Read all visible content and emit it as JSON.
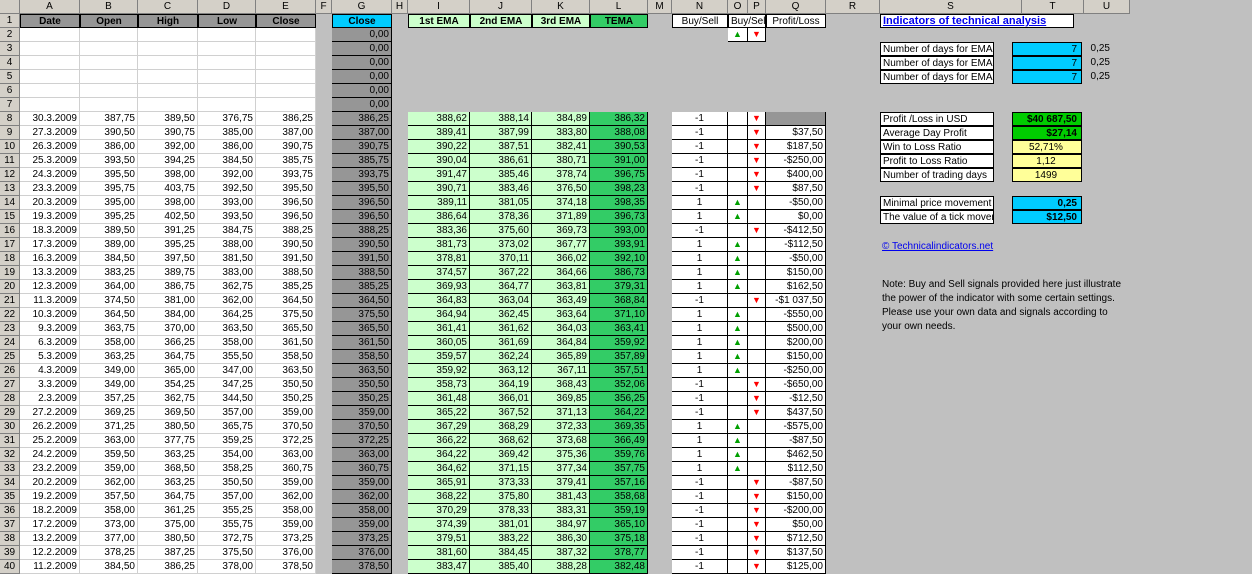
{
  "columns": [
    "A",
    "B",
    "C",
    "D",
    "E",
    "F",
    "G",
    "H",
    "I",
    "J",
    "K",
    "L",
    "M",
    "N",
    "O",
    "P",
    "Q",
    "R",
    "S",
    "T",
    "U"
  ],
  "header_labels": {
    "date": "Date",
    "open": "Open",
    "high": "High",
    "low": "Low",
    "close": "Close",
    "close2": "Close",
    "ema1": "1st EMA",
    "ema2": "2nd EMA",
    "ema3": "3rd EMA",
    "tema": "TEMA",
    "buysell": "Buy/Sell",
    "buysell2": "Buy/Sell",
    "profitloss": "Profit/Loss"
  },
  "signal_arrows": {
    "up": "▲",
    "down": "▼"
  },
  "empty_close": [
    "0,00",
    "0,00",
    "0,00",
    "0,00",
    "0,00",
    "0,00"
  ],
  "rows": [
    {
      "date": "30.3.2009",
      "open": "387,75",
      "high": "389,50",
      "low": "376,75",
      "close": "386,25",
      "g": "386,25",
      "i": "388,62",
      "j": "388,14",
      "k": "384,89",
      "l": "386,32",
      "n": "-1",
      "sig": "down",
      "q": ""
    },
    {
      "date": "27.3.2009",
      "open": "390,50",
      "high": "390,75",
      "low": "385,00",
      "close": "387,00",
      "g": "387,00",
      "i": "389,41",
      "j": "387,99",
      "k": "383,80",
      "l": "388,08",
      "n": "-1",
      "sig": "down",
      "q": "$37,50"
    },
    {
      "date": "26.3.2009",
      "open": "386,00",
      "high": "392,00",
      "low": "386,00",
      "close": "390,75",
      "g": "390,75",
      "i": "390,22",
      "j": "387,51",
      "k": "382,41",
      "l": "390,53",
      "n": "-1",
      "sig": "down",
      "q": "$187,50"
    },
    {
      "date": "25.3.2009",
      "open": "393,50",
      "high": "394,25",
      "low": "384,50",
      "close": "385,75",
      "g": "385,75",
      "i": "390,04",
      "j": "386,61",
      "k": "380,71",
      "l": "391,00",
      "n": "-1",
      "sig": "down",
      "q": "-$250,00"
    },
    {
      "date": "24.3.2009",
      "open": "395,50",
      "high": "398,00",
      "low": "392,00",
      "close": "393,75",
      "g": "393,75",
      "i": "391,47",
      "j": "385,46",
      "k": "378,74",
      "l": "396,75",
      "n": "-1",
      "sig": "down",
      "q": "$400,00"
    },
    {
      "date": "23.3.2009",
      "open": "395,75",
      "high": "403,75",
      "low": "392,50",
      "close": "395,50",
      "g": "395,50",
      "i": "390,71",
      "j": "383,46",
      "k": "376,50",
      "l": "398,23",
      "n": "-1",
      "sig": "down",
      "q": "$87,50"
    },
    {
      "date": "20.3.2009",
      "open": "395,00",
      "high": "398,00",
      "low": "393,00",
      "close": "396,50",
      "g": "396,50",
      "i": "389,11",
      "j": "381,05",
      "k": "374,18",
      "l": "398,35",
      "n": "1",
      "sig": "up",
      "q": "-$50,00"
    },
    {
      "date": "19.3.2009",
      "open": "395,25",
      "high": "402,50",
      "low": "393,50",
      "close": "396,50",
      "g": "396,50",
      "i": "386,64",
      "j": "378,36",
      "k": "371,89",
      "l": "396,73",
      "n": "1",
      "sig": "up",
      "q": "$0,00"
    },
    {
      "date": "18.3.2009",
      "open": "389,50",
      "high": "391,25",
      "low": "384,75",
      "close": "388,25",
      "g": "388,25",
      "i": "383,36",
      "j": "375,60",
      "k": "369,73",
      "l": "393,00",
      "n": "-1",
      "sig": "down",
      "q": "-$412,50"
    },
    {
      "date": "17.3.2009",
      "open": "389,00",
      "high": "395,25",
      "low": "388,00",
      "close": "390,50",
      "g": "390,50",
      "i": "381,73",
      "j": "373,02",
      "k": "367,77",
      "l": "393,91",
      "n": "1",
      "sig": "up",
      "q": "-$112,50"
    },
    {
      "date": "16.3.2009",
      "open": "384,50",
      "high": "397,50",
      "low": "381,50",
      "close": "391,50",
      "g": "391,50",
      "i": "378,81",
      "j": "370,11",
      "k": "366,02",
      "l": "392,10",
      "n": "1",
      "sig": "up",
      "q": "-$50,00"
    },
    {
      "date": "13.3.2009",
      "open": "383,25",
      "high": "389,75",
      "low": "383,00",
      "close": "388,50",
      "g": "388,50",
      "i": "374,57",
      "j": "367,22",
      "k": "364,66",
      "l": "386,73",
      "n": "1",
      "sig": "up",
      "q": "$150,00"
    },
    {
      "date": "12.3.2009",
      "open": "364,00",
      "high": "386,75",
      "low": "362,75",
      "close": "385,25",
      "g": "385,25",
      "i": "369,93",
      "j": "364,77",
      "k": "363,81",
      "l": "379,31",
      "n": "1",
      "sig": "up",
      "q": "$162,50"
    },
    {
      "date": "11.3.2009",
      "open": "374,50",
      "high": "381,00",
      "low": "362,00",
      "close": "364,50",
      "g": "364,50",
      "i": "364,83",
      "j": "363,04",
      "k": "363,49",
      "l": "368,84",
      "n": "-1",
      "sig": "down",
      "q": "-$1 037,50"
    },
    {
      "date": "10.3.2009",
      "open": "364,50",
      "high": "384,00",
      "low": "364,25",
      "close": "375,50",
      "g": "375,50",
      "i": "364,94",
      "j": "362,45",
      "k": "363,64",
      "l": "371,10",
      "n": "1",
      "sig": "up",
      "q": "-$550,00"
    },
    {
      "date": "9.3.2009",
      "open": "363,75",
      "high": "370,00",
      "low": "363,50",
      "close": "365,50",
      "g": "365,50",
      "i": "361,41",
      "j": "361,62",
      "k": "364,03",
      "l": "363,41",
      "n": "1",
      "sig": "up",
      "q": "$500,00"
    },
    {
      "date": "6.3.2009",
      "open": "358,00",
      "high": "366,25",
      "low": "358,00",
      "close": "361,50",
      "g": "361,50",
      "i": "360,05",
      "j": "361,69",
      "k": "364,84",
      "l": "359,92",
      "n": "1",
      "sig": "up",
      "q": "$200,00"
    },
    {
      "date": "5.3.2009",
      "open": "363,25",
      "high": "364,75",
      "low": "355,50",
      "close": "358,50",
      "g": "358,50",
      "i": "359,57",
      "j": "362,24",
      "k": "365,89",
      "l": "357,89",
      "n": "1",
      "sig": "up",
      "q": "$150,00"
    },
    {
      "date": "4.3.2009",
      "open": "349,00",
      "high": "365,00",
      "low": "347,00",
      "close": "363,50",
      "g": "363,50",
      "i": "359,92",
      "j": "363,12",
      "k": "367,11",
      "l": "357,51",
      "n": "1",
      "sig": "up",
      "q": "-$250,00"
    },
    {
      "date": "3.3.2009",
      "open": "349,00",
      "high": "354,25",
      "low": "347,25",
      "close": "350,50",
      "g": "350,50",
      "i": "358,73",
      "j": "364,19",
      "k": "368,43",
      "l": "352,06",
      "n": "-1",
      "sig": "down",
      "q": "-$650,00"
    },
    {
      "date": "2.3.2009",
      "open": "357,25",
      "high": "362,75",
      "low": "344,50",
      "close": "350,25",
      "g": "350,25",
      "i": "361,48",
      "j": "366,01",
      "k": "369,85",
      "l": "356,25",
      "n": "-1",
      "sig": "down",
      "q": "-$12,50"
    },
    {
      "date": "27.2.2009",
      "open": "369,25",
      "high": "369,50",
      "low": "357,00",
      "close": "359,00",
      "g": "359,00",
      "i": "365,22",
      "j": "367,52",
      "k": "371,13",
      "l": "364,22",
      "n": "-1",
      "sig": "down",
      "q": "$437,50"
    },
    {
      "date": "26.2.2009",
      "open": "371,25",
      "high": "380,50",
      "low": "365,75",
      "close": "370,50",
      "g": "370,50",
      "i": "367,29",
      "j": "368,29",
      "k": "372,33",
      "l": "369,35",
      "n": "1",
      "sig": "up",
      "q": "-$575,00"
    },
    {
      "date": "25.2.2009",
      "open": "363,00",
      "high": "377,75",
      "low": "359,25",
      "close": "372,25",
      "g": "372,25",
      "i": "366,22",
      "j": "368,62",
      "k": "373,68",
      "l": "366,49",
      "n": "1",
      "sig": "up",
      "q": "-$87,50"
    },
    {
      "date": "24.2.2009",
      "open": "359,50",
      "high": "363,25",
      "low": "354,00",
      "close": "363,00",
      "g": "363,00",
      "i": "364,22",
      "j": "369,42",
      "k": "375,36",
      "l": "359,76",
      "n": "1",
      "sig": "up",
      "q": "$462,50"
    },
    {
      "date": "23.2.2009",
      "open": "359,00",
      "high": "368,50",
      "low": "358,25",
      "close": "360,75",
      "g": "360,75",
      "i": "364,62",
      "j": "371,15",
      "k": "377,34",
      "l": "357,75",
      "n": "1",
      "sig": "up",
      "q": "$112,50"
    },
    {
      "date": "20.2.2009",
      "open": "362,00",
      "high": "363,25",
      "low": "350,50",
      "close": "359,00",
      "g": "359,00",
      "i": "365,91",
      "j": "373,33",
      "k": "379,41",
      "l": "357,16",
      "n": "-1",
      "sig": "down",
      "q": "-$87,50"
    },
    {
      "date": "19.2.2009",
      "open": "357,50",
      "high": "364,75",
      "low": "357,00",
      "close": "362,00",
      "g": "362,00",
      "i": "368,22",
      "j": "375,80",
      "k": "381,43",
      "l": "358,68",
      "n": "-1",
      "sig": "down",
      "q": "$150,00"
    },
    {
      "date": "18.2.2009",
      "open": "358,00",
      "high": "361,25",
      "low": "355,25",
      "close": "358,00",
      "g": "358,00",
      "i": "370,29",
      "j": "378,33",
      "k": "383,31",
      "l": "359,19",
      "n": "-1",
      "sig": "down",
      "q": "-$200,00"
    },
    {
      "date": "17.2.2009",
      "open": "373,00",
      "high": "375,00",
      "low": "355,75",
      "close": "359,00",
      "g": "359,00",
      "i": "374,39",
      "j": "381,01",
      "k": "384,97",
      "l": "365,10",
      "n": "-1",
      "sig": "down",
      "q": "$50,00"
    },
    {
      "date": "13.2.2009",
      "open": "377,00",
      "high": "380,50",
      "low": "372,75",
      "close": "373,25",
      "g": "373,25",
      "i": "379,51",
      "j": "383,22",
      "k": "386,30",
      "l": "375,18",
      "n": "-1",
      "sig": "down",
      "q": "$712,50"
    },
    {
      "date": "12.2.2009",
      "open": "378,25",
      "high": "387,25",
      "low": "375,50",
      "close": "376,00",
      "g": "376,00",
      "i": "381,60",
      "j": "384,45",
      "k": "387,32",
      "l": "378,77",
      "n": "-1",
      "sig": "down",
      "q": "$137,50"
    },
    {
      "date": "11.2.2009",
      "open": "384,50",
      "high": "386,25",
      "low": "378,00",
      "close": "378,50",
      "g": "378,50",
      "i": "383,47",
      "j": "385,40",
      "k": "388,28",
      "l": "382,48",
      "n": "-1",
      "sig": "down",
      "q": "$125,00"
    }
  ],
  "side": {
    "title": "Indicators of technical analysis",
    "params": [
      {
        "label": "Number of days for EMA",
        "value": "7",
        "alpha": "0,25"
      },
      {
        "label": "Number of days for EMA of EMA",
        "value": "7",
        "alpha": "0,25"
      },
      {
        "label": "Number of days for EMA of EMA of EMA",
        "value": "7",
        "alpha": "0,25"
      }
    ],
    "stats": [
      {
        "label": "Profit /Loss in USD",
        "value": "$40 687,50",
        "color": "#00cc00"
      },
      {
        "label": "Average Day Profit",
        "value": "$27,14",
        "color": "#00cc00"
      },
      {
        "label": "Win to Loss Ratio",
        "value": "52,71%",
        "color": "#ffff99"
      },
      {
        "label": "Profit to Loss Ratio",
        "value": "1,12",
        "color": "#ffff99"
      },
      {
        "label": "Number of trading days",
        "value": "1499",
        "color": "#ffff99"
      }
    ],
    "tick": [
      {
        "label": "Minimal price movement in points",
        "value": "0,25"
      },
      {
        "label": "The value of a tick movement in USD",
        "value": "$12,50"
      }
    ],
    "link": "© Technicalindicators.net",
    "note": "Note: Buy and Sell signals provided here just illustrate the power of the indicator with some certain settings. Please use your own data and signals according to your own needs."
  }
}
